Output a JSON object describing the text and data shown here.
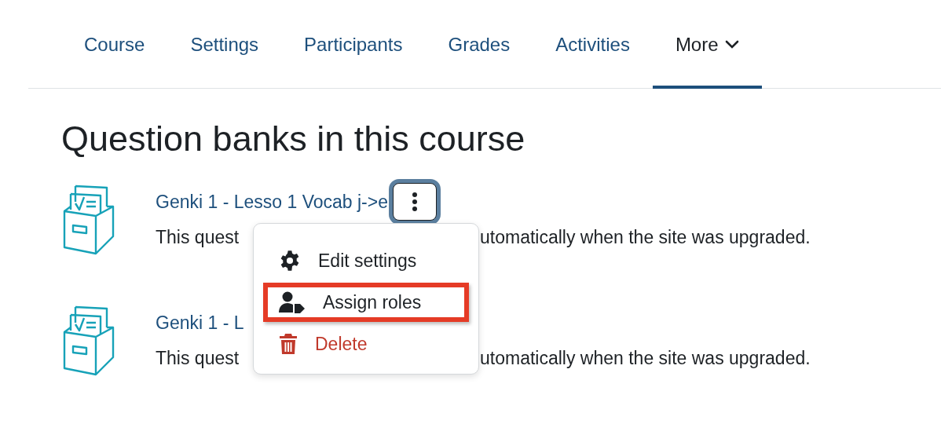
{
  "tabs": [
    {
      "label": "Course",
      "selected": false
    },
    {
      "label": "Settings",
      "selected": false
    },
    {
      "label": "Participants",
      "selected": false
    },
    {
      "label": "Grades",
      "selected": false
    },
    {
      "label": "Activities",
      "selected": false
    },
    {
      "label": "More",
      "selected": true,
      "dropdown": true
    }
  ],
  "heading": "Question banks in this course",
  "banks": [
    {
      "title": "Genki 1 - Lesso 1 Vocab j->e",
      "description_parts": [
        "This quest",
        "utomatically when the site was upgraded."
      ],
      "menu_button": true,
      "focused": true
    },
    {
      "title": "Genki 1 - L",
      "description_parts": [
        "This quest",
        "utomatically when the site was upgraded."
      ],
      "menu_button": false
    }
  ],
  "menu": {
    "items": [
      {
        "kind": "settings",
        "label": "Edit settings",
        "highlighted": false
      },
      {
        "kind": "roles",
        "label": "Assign roles",
        "highlighted": true
      },
      {
        "kind": "delete",
        "label": "Delete",
        "highlighted": false
      }
    ]
  }
}
